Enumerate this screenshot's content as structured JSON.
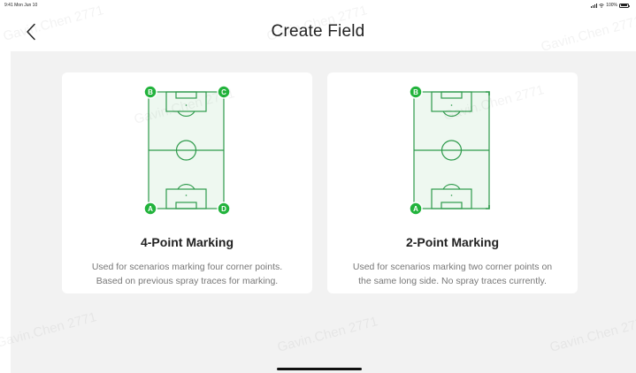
{
  "status_bar": {
    "time": "9:41  Mon Jun 10",
    "battery": "100%"
  },
  "header": {
    "back_icon": "chevron-left-icon",
    "title": "Create Field"
  },
  "cards": [
    {
      "title": "4-Point Marking",
      "description_line1": "Used for scenarios marking four corner points.",
      "description_line2": "Based on previous spray traces for marking.",
      "markers": [
        "B",
        "C",
        "A",
        "D"
      ]
    },
    {
      "title": "2-Point Marking",
      "description_line1": "Used for scenarios marking two corner points on",
      "description_line2": "the same long side. No spray traces currently.",
      "markers": [
        "B",
        "A"
      ]
    }
  ],
  "watermark": "Gavin.Chen 2771",
  "colors": {
    "pitch_line": "#2e9a4b",
    "pitch_fill": "#eef8f0",
    "marker": "#22b33c",
    "background": "#f2f2f2"
  }
}
